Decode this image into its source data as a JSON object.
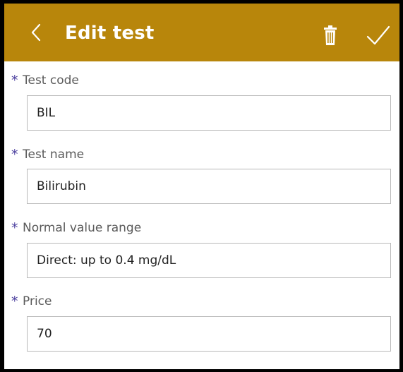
{
  "header": {
    "title": "Edit test",
    "background": "#B8860B",
    "back_icon": "chevron-left-icon",
    "delete_icon": "trash-icon",
    "save_icon": "checkmark-icon"
  },
  "form": {
    "required_marker": "*",
    "fields": [
      {
        "label": "Test code",
        "value": "BIL"
      },
      {
        "label": "Test name",
        "value": "Bilirubin"
      },
      {
        "label": "Normal value range",
        "value": "Direct: up to 0.4 mg/dL"
      },
      {
        "label": "Price",
        "value": "70"
      }
    ]
  }
}
